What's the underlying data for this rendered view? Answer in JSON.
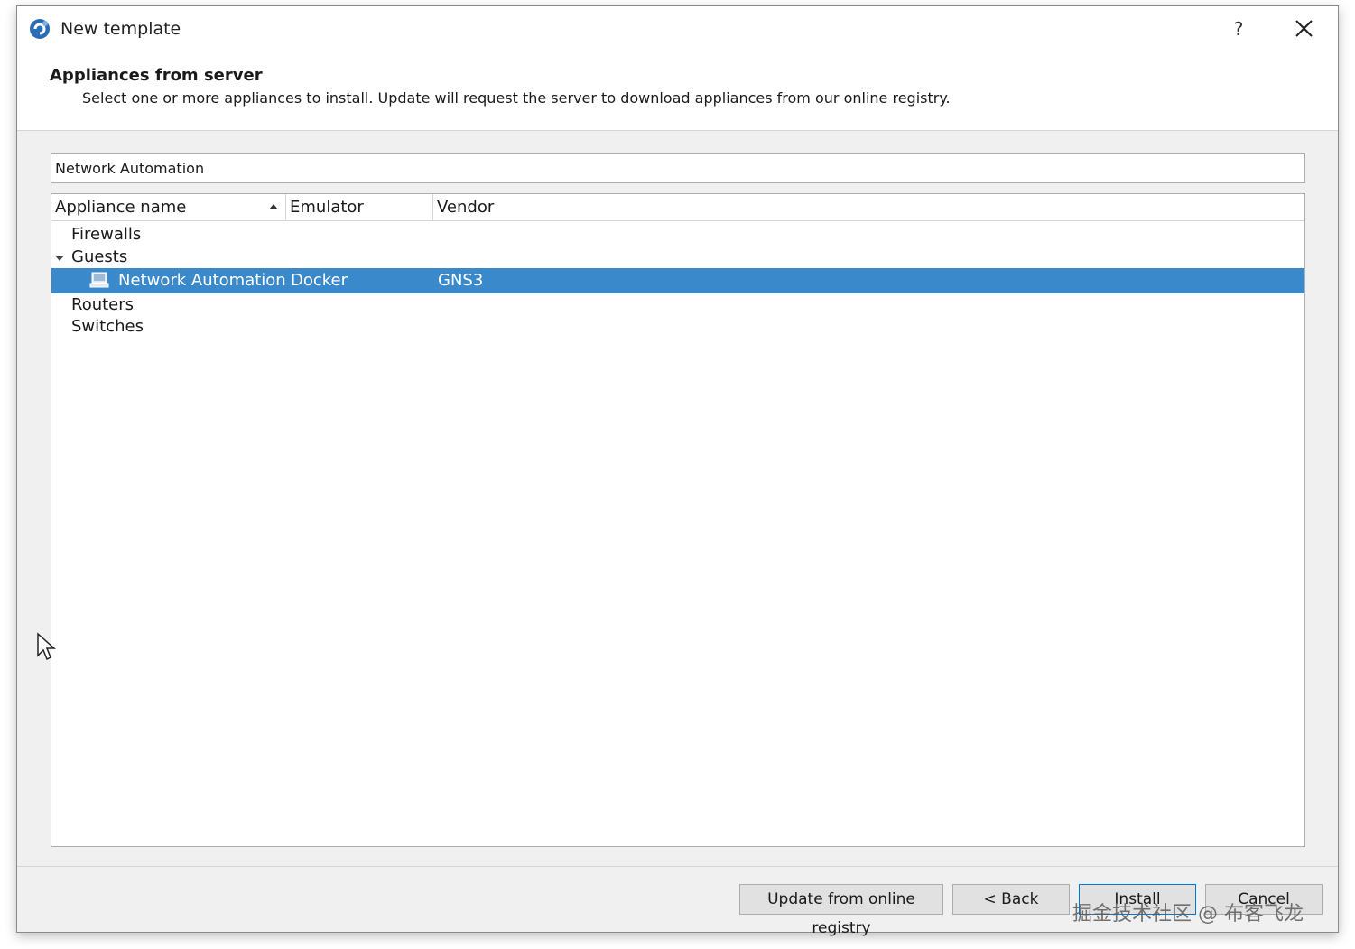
{
  "window": {
    "title": "New template",
    "help_label": "?"
  },
  "header": {
    "title": "Appliances from server",
    "subtitle": "Select one or more appliances to install. Update will request the server to download appliances from our online registry."
  },
  "search": {
    "value": "Network Automation"
  },
  "tree": {
    "columns": [
      "Appliance name",
      "Emulator",
      "Vendor"
    ],
    "categories": [
      {
        "label": "Firewalls"
      },
      {
        "label": "Guests"
      },
      {
        "label": "Routers"
      },
      {
        "label": "Switches"
      }
    ],
    "selected_item": {
      "name": "Network Automation",
      "emulator": "Docker",
      "vendor": "GNS3"
    }
  },
  "buttons": {
    "update": "Update from online registry",
    "back": "< Back",
    "install": "Install",
    "cancel": "Cancel"
  },
  "watermark": "掘金技术社区 @ 布客飞龙",
  "colors": {
    "selection": "#3a8acb",
    "dialog_bg": "#f0f0f0"
  }
}
